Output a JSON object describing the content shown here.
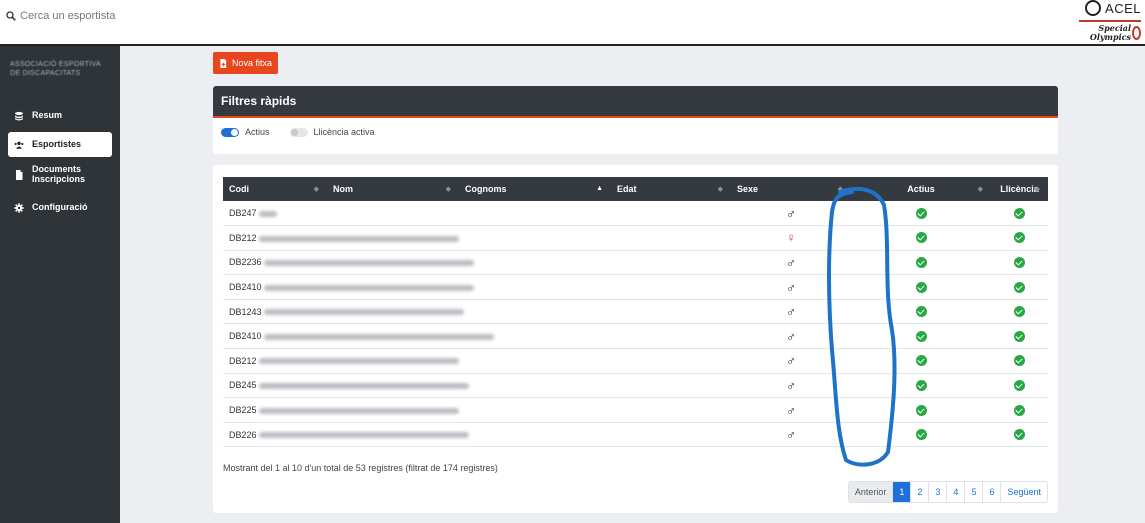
{
  "search": {
    "placeholder": "Cerca un esportista"
  },
  "brand": {
    "name": "ACEL",
    "partner_line1": "Special",
    "partner_line2": "Olympics"
  },
  "sidebar": {
    "org_name_line1": "ASSOCIACIÓ ESPORTIVA",
    "org_name_line2": "DE DISCAPACITATS",
    "items": [
      {
        "label": "Resum",
        "icon": "dashboard-icon"
      },
      {
        "label": "Esportistes",
        "icon": "users-icon"
      },
      {
        "label": "Documents",
        "label2": "Inscripcions",
        "icon": "document-icon"
      },
      {
        "label": "Configuració",
        "icon": "gear-icon"
      }
    ]
  },
  "toolbar": {
    "new_label": "Nova fitxa"
  },
  "filters": {
    "title": "Filtres ràpids",
    "toggle_active": {
      "label": "Actius",
      "on": true
    },
    "toggle_license": {
      "label": "Llicència activa",
      "on": false
    }
  },
  "table": {
    "columns": [
      "Codi",
      "Nom",
      "Cognoms",
      "Edat",
      "Sexe",
      "Actius",
      "Llicència"
    ],
    "rows": [
      {
        "code": "DB247",
        "sex": "male",
        "active": true,
        "license": true
      },
      {
        "code": "DB212",
        "sex": "female",
        "active": true,
        "license": true
      },
      {
        "code": "DB2236",
        "sex": "male",
        "active": true,
        "license": true
      },
      {
        "code": "DB2410",
        "sex": "male",
        "active": true,
        "license": true
      },
      {
        "code": "DB1243",
        "sex": "male",
        "active": true,
        "license": true
      },
      {
        "code": "DB2410",
        "sex": "male",
        "active": true,
        "license": true
      },
      {
        "code": "DB212",
        "sex": "male",
        "active": true,
        "license": true
      },
      {
        "code": "DB245",
        "sex": "male",
        "active": true,
        "license": true
      },
      {
        "code": "DB225",
        "sex": "male",
        "active": true,
        "license": true
      },
      {
        "code": "DB226",
        "sex": "male",
        "active": true,
        "license": true
      }
    ],
    "info": "Mostrant del 1 al 10 d'un total de 53 registres (filtrat de 174 registres)"
  },
  "pagination": {
    "prev": "Anterior",
    "pages": [
      "1",
      "2",
      "3",
      "4",
      "5",
      "6"
    ],
    "current": "1",
    "next": "Següent"
  },
  "colors": {
    "accent": "#e8461e",
    "primary": "#1e6fd9",
    "sidebar": "#2f3439",
    "success": "#28a745",
    "annotation": "#1e73c8"
  }
}
